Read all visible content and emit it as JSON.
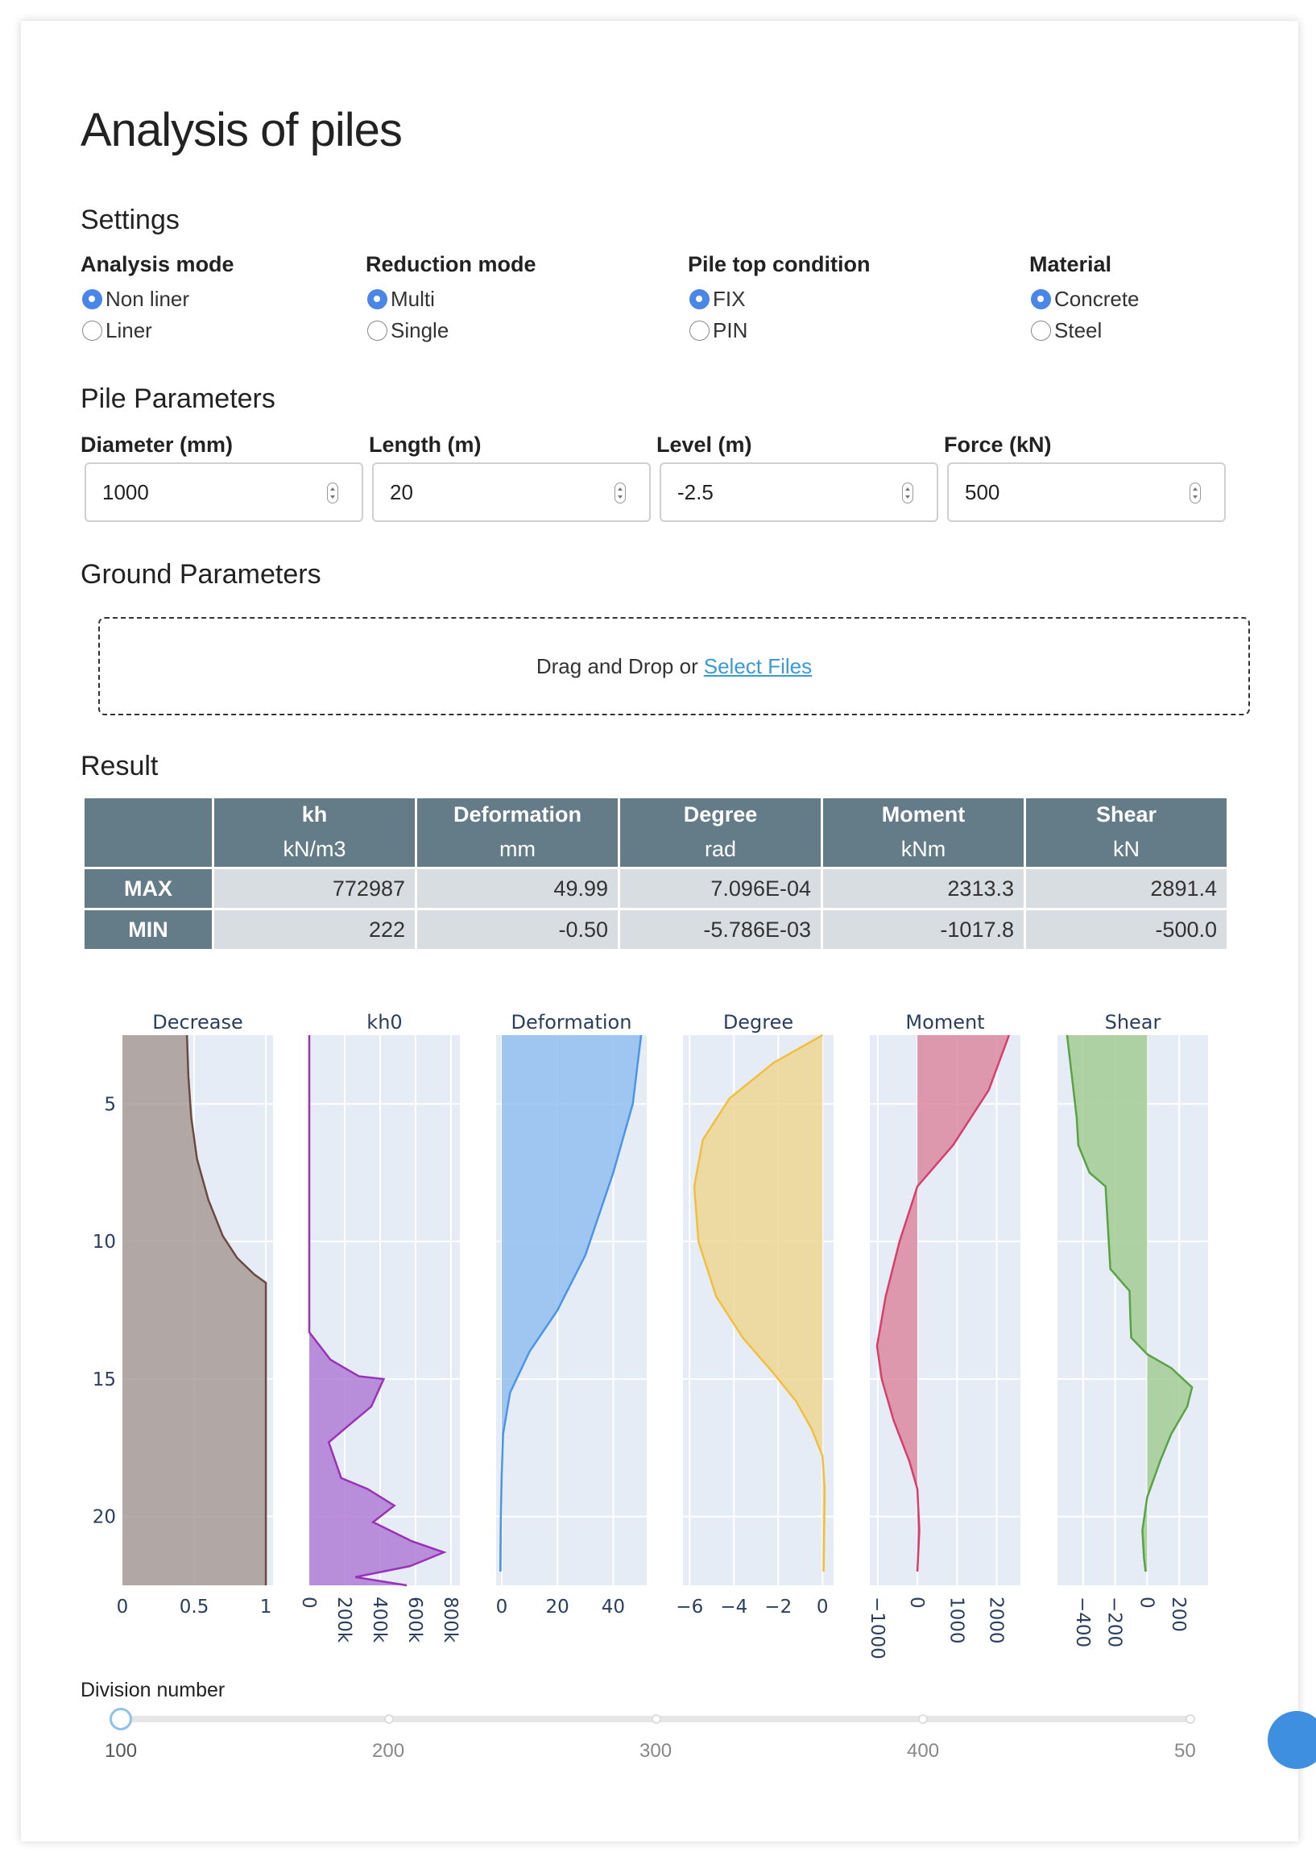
{
  "page": {
    "title": "Analysis of piles"
  },
  "settings": {
    "heading": "Settings",
    "groups": [
      {
        "title": "Analysis mode",
        "options": [
          "Non liner",
          "Liner"
        ],
        "selected": 0
      },
      {
        "title": "Reduction mode",
        "options": [
          "Multi",
          "Single"
        ],
        "selected": 0
      },
      {
        "title": "Pile top condition",
        "options": [
          "FIX",
          "PIN"
        ],
        "selected": 0
      },
      {
        "title": "Material",
        "options": [
          "Concrete",
          "Steel"
        ],
        "selected": 0
      }
    ]
  },
  "pile": {
    "heading": "Pile Parameters",
    "fields": [
      {
        "label": "Diameter (mm)",
        "value": "1000"
      },
      {
        "label": "Length (m)",
        "value": "20"
      },
      {
        "label": "Level (m)",
        "value": "-2.5"
      },
      {
        "label": "Force (kN)",
        "value": "500"
      }
    ]
  },
  "ground": {
    "heading": "Ground Parameters",
    "drop_text": "Drag and Drop or",
    "drop_link": "Select Files"
  },
  "result": {
    "heading": "Result",
    "columns": [
      {
        "name": "kh",
        "unit": "kN/m3"
      },
      {
        "name": "Deformation",
        "unit": "mm"
      },
      {
        "name": "Degree",
        "unit": "rad"
      },
      {
        "name": "Moment",
        "unit": "kNm"
      },
      {
        "name": "Shear",
        "unit": "kN"
      }
    ],
    "rows": [
      {
        "label": "MAX",
        "values": [
          "772987",
          "49.99",
          "7.096E-04",
          "2313.3",
          "2891.4"
        ]
      },
      {
        "label": "MIN",
        "values": [
          "222",
          "-0.50",
          "-5.786E-03",
          "-1017.8",
          "-500.0"
        ]
      }
    ]
  },
  "colors": {
    "accent": "#4a86e8",
    "table_header": "#647b88",
    "table_cell": "#d7dde1",
    "plot_bg": "#e5ecf6",
    "link": "#3a9ad9"
  },
  "chart_data": [
    {
      "type": "area",
      "title": "Decrease",
      "ylim": [
        22.5,
        2.5
      ],
      "xlim": [
        0,
        1.05
      ],
      "xticks": [
        {
          "v": 0,
          "t": "0"
        },
        {
          "v": 0.5,
          "t": "0.5"
        },
        {
          "v": 1,
          "t": "1"
        }
      ],
      "yticks": [
        5,
        10,
        15,
        20
      ],
      "fill_color": "#a89c98",
      "line_color": "#6b4a40",
      "points": [
        [
          0.45,
          2.5
        ],
        [
          0.46,
          4
        ],
        [
          0.48,
          5.5
        ],
        [
          0.52,
          7
        ],
        [
          0.6,
          8.5
        ],
        [
          0.7,
          9.8
        ],
        [
          0.8,
          10.6
        ],
        [
          0.92,
          11.2
        ],
        [
          1,
          11.5
        ],
        [
          1,
          22.5
        ]
      ]
    },
    {
      "type": "area",
      "title": "kh0",
      "ylim": [
        22.5,
        2.5
      ],
      "xlim": [
        0,
        850000
      ],
      "xticks": [
        {
          "v": 0,
          "t": "0"
        },
        {
          "v": 200000,
          "t": "200k"
        },
        {
          "v": 400000,
          "t": "400k"
        },
        {
          "v": 600000,
          "t": "600k"
        },
        {
          "v": 800000,
          "t": "800k"
        }
      ],
      "fill_color": "#b07cd4",
      "line_color": "#9a32b8",
      "points": [
        [
          0,
          2.5
        ],
        [
          0,
          13.3
        ],
        [
          120000,
          14.3
        ],
        [
          280000,
          14.9
        ],
        [
          420000,
          15.0
        ],
        [
          350000,
          16.0
        ],
        [
          220000,
          16.7
        ],
        [
          110000,
          17.3
        ],
        [
          180000,
          18.6
        ],
        [
          330000,
          19.0
        ],
        [
          480000,
          19.6
        ],
        [
          360000,
          20.2
        ],
        [
          580000,
          20.9
        ],
        [
          760000,
          21.3
        ],
        [
          570000,
          21.8
        ],
        [
          260000,
          22.2
        ],
        [
          550000,
          22.5
        ]
      ]
    },
    {
      "type": "area",
      "title": "Deformation",
      "ylim": [
        22.5,
        2.5
      ],
      "xlim": [
        -2,
        52
      ],
      "xticks": [
        {
          "v": 0,
          "t": "0"
        },
        {
          "v": 20,
          "t": "20"
        },
        {
          "v": 40,
          "t": "40"
        }
      ],
      "fill_color": "#93bff0",
      "line_color": "#4c94e8",
      "points": [
        [
          49.99,
          2.5
        ],
        [
          47,
          5
        ],
        [
          40,
          7.5
        ],
        [
          30,
          10.5
        ],
        [
          20,
          12.5
        ],
        [
          10,
          14
        ],
        [
          3,
          15.5
        ],
        [
          0.5,
          17
        ],
        [
          0,
          18.5
        ],
        [
          -0.3,
          20
        ],
        [
          -0.5,
          22
        ]
      ]
    },
    {
      "type": "area",
      "title": "Degree",
      "ylim": [
        22.5,
        2.5
      ],
      "xlim": [
        -6.3,
        0.5
      ],
      "xticks": [
        {
          "v": -6,
          "t": "−6"
        },
        {
          "v": -4,
          "t": "−4"
        },
        {
          "v": -2,
          "t": "−2"
        },
        {
          "v": 0,
          "t": "0"
        }
      ],
      "fill_color": "#eed794",
      "line_color": "#f0bf40",
      "points": [
        [
          0,
          2.5
        ],
        [
          -2.2,
          3.5
        ],
        [
          -4.2,
          4.8
        ],
        [
          -5.4,
          6.3
        ],
        [
          -5.79,
          8
        ],
        [
          -5.6,
          10
        ],
        [
          -4.8,
          12
        ],
        [
          -3.6,
          13.5
        ],
        [
          -2.2,
          14.8
        ],
        [
          -1.2,
          15.8
        ],
        [
          -0.5,
          16.8
        ],
        [
          0,
          17.8
        ],
        [
          0.1,
          19
        ],
        [
          0.05,
          22
        ]
      ]
    },
    {
      "type": "area",
      "title": "Moment",
      "ylim": [
        22.5,
        2.5
      ],
      "xlim": [
        -1200,
        2600
      ],
      "xticks": [
        {
          "v": -1000,
          "t": "−1000"
        },
        {
          "v": 0,
          "t": "0"
        },
        {
          "v": 1000,
          "t": "1000"
        },
        {
          "v": 2000,
          "t": "2000"
        }
      ],
      "rotate_xticks": true,
      "fill_color": "#dd8aa0",
      "line_color": "#d63f6a",
      "points": [
        [
          2313,
          2.5
        ],
        [
          1800,
          4.5
        ],
        [
          900,
          6.5
        ],
        [
          0,
          8
        ],
        [
          -450,
          10
        ],
        [
          -800,
          12
        ],
        [
          -1018,
          13.8
        ],
        [
          -900,
          15
        ],
        [
          -600,
          16.5
        ],
        [
          -200,
          18
        ],
        [
          0,
          19
        ],
        [
          50,
          20.5
        ],
        [
          0,
          22
        ]
      ]
    },
    {
      "type": "area",
      "title": "Shear",
      "ylim": [
        22.5,
        2.5
      ],
      "xlim": [
        -560,
        380
      ],
      "xticks": [
        {
          "v": -400,
          "t": "−400"
        },
        {
          "v": -200,
          "t": "−200"
        },
        {
          "v": 0,
          "t": "0"
        },
        {
          "v": 200,
          "t": "200"
        }
      ],
      "rotate_xticks": true,
      "fill_color": "#a3cd93",
      "line_color": "#5ba146",
      "points": [
        [
          -500,
          2.5
        ],
        [
          -470,
          4
        ],
        [
          -440,
          5.5
        ],
        [
          -430,
          6.5
        ],
        [
          -360,
          7.5
        ],
        [
          -260,
          8
        ],
        [
          -250,
          9
        ],
        [
          -240,
          10
        ],
        [
          -230,
          11
        ],
        [
          -110,
          11.8
        ],
        [
          -105,
          12.8
        ],
        [
          -100,
          13.5
        ],
        [
          0,
          14.1
        ],
        [
          150,
          14.6
        ],
        [
          280,
          15.3
        ],
        [
          250,
          16
        ],
        [
          150,
          17
        ],
        [
          80,
          18
        ],
        [
          0,
          19.3
        ],
        [
          -30,
          20.5
        ],
        [
          -20,
          21.5
        ],
        [
          -10,
          22
        ]
      ]
    }
  ],
  "slider": {
    "label": "Division number",
    "marks": [
      "100",
      "200",
      "300",
      "400",
      "50"
    ],
    "value": "100"
  }
}
